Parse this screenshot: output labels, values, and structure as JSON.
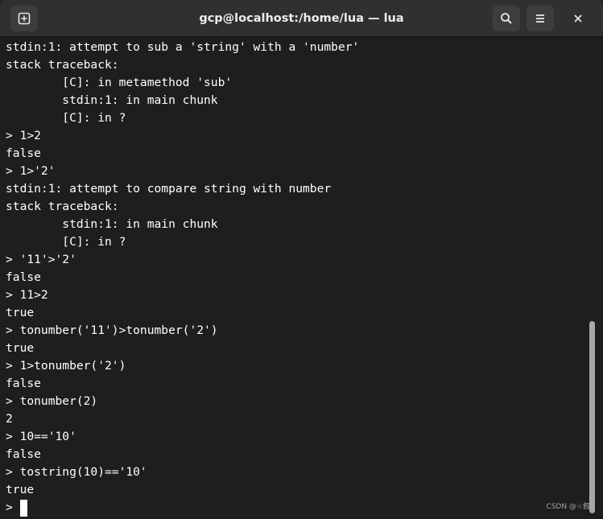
{
  "window": {
    "title": "gcp@localhost:/home/lua — lua"
  },
  "icons": {
    "new_tab": "new-tab-icon",
    "search": "search-icon",
    "menu": "hamburger-menu-icon",
    "close": "close-icon"
  },
  "terminal": {
    "lines": [
      "stdin:1: attempt to sub a 'string' with a 'number'",
      "stack traceback:",
      "        [C]: in metamethod 'sub'",
      "        stdin:1: in main chunk",
      "        [C]: in ?",
      "> 1>2",
      "false",
      "> 1>'2'",
      "stdin:1: attempt to compare string with number",
      "stack traceback:",
      "        stdin:1: in main chunk",
      "        [C]: in ?",
      "> '11'>'2'",
      "false",
      "> 11>2",
      "true",
      "> tonumber('11')>tonumber('2')",
      "true",
      "> 1>tonumber('2')",
      "false",
      "> tonumber(2)",
      "2",
      "> 10=='10'",
      "false",
      "> tostring(10)=='10'",
      "true"
    ],
    "prompt": ">"
  },
  "watermark": "CSDN @☆叙"
}
